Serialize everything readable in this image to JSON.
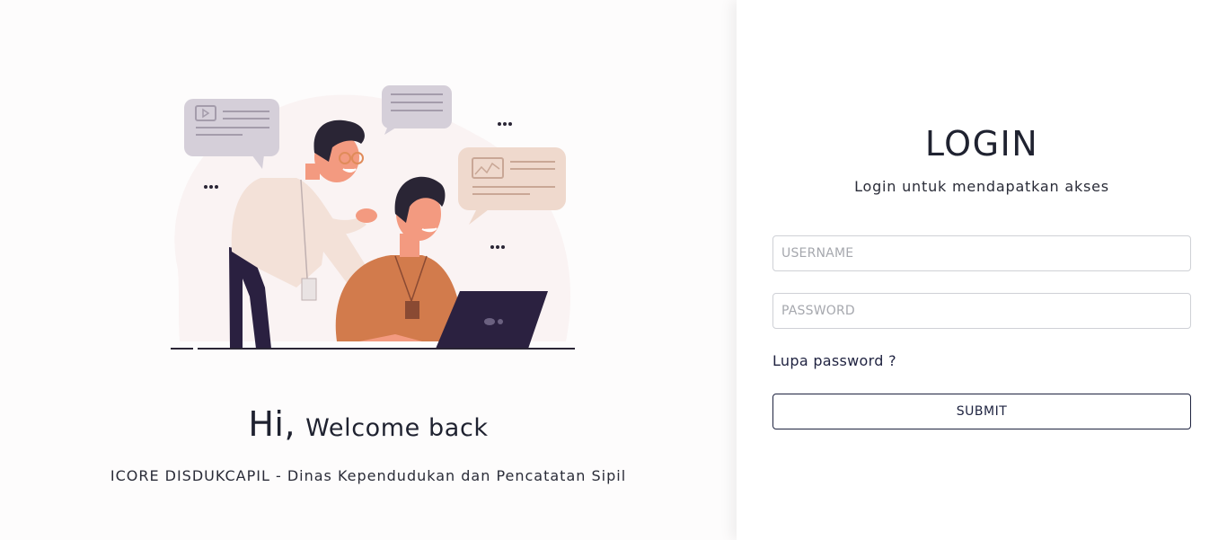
{
  "hero": {
    "greeting": "Hi,",
    "welcome": "Welcome back",
    "organization": "ICORE DISDUKCAPIL - Dinas Kependudukan dan Pencatatan Sipil"
  },
  "login": {
    "title": "LOGIN",
    "subtitle": "Login untuk mendapatkan akses",
    "username_placeholder": "USERNAME",
    "password_placeholder": "PASSWORD",
    "forgot_link": "Lupa password ?",
    "submit_label": "SUBMIT"
  },
  "colors": {
    "primary_text": "#1f2230",
    "button_border": "#1e2340",
    "input_border": "#cfd1d6",
    "illustration_blob": "#faf3f3",
    "shirt_orange": "#d27b4c",
    "laptop": "#2b2140"
  }
}
